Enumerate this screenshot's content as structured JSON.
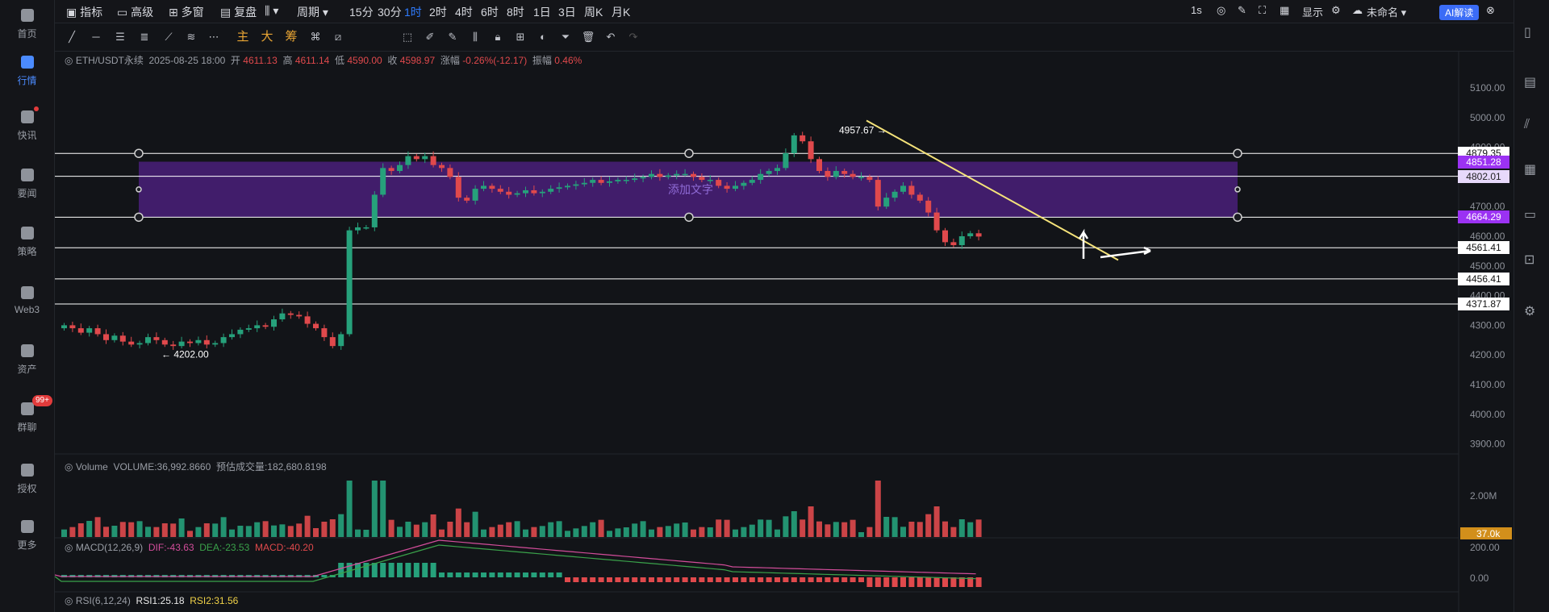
{
  "nav": [
    {
      "label": "首页",
      "icon": "home-icon"
    },
    {
      "label": "行情",
      "icon": "bar-chart-icon",
      "active": true
    },
    {
      "label": "快讯",
      "icon": "news-icon",
      "dot": true
    },
    {
      "label": "要闻",
      "icon": "document-icon"
    },
    {
      "label": "策略",
      "icon": "robot-icon"
    },
    {
      "label": "Web3",
      "icon": "web3-icon"
    },
    {
      "label": "资产",
      "icon": "wallet-icon"
    },
    {
      "label": "群聊",
      "icon": "chat-icon",
      "badge": "99+"
    },
    {
      "label": "授权",
      "icon": "key-icon"
    },
    {
      "label": "更多",
      "icon": "grid-icon"
    }
  ],
  "topbar": {
    "indicators": "指标",
    "advanced": "高级",
    "multi_window": "多窗",
    "replay": "复盘",
    "period": "周期",
    "intervals": [
      "15分",
      "30分",
      "1时",
      "2时",
      "4时",
      "6时",
      "8时",
      "1日",
      "3日",
      "周K",
      "月K"
    ],
    "selected_interval": "1时",
    "right_speed": "1s",
    "display": "显示",
    "unnamed": "未命名",
    "ai": "AI解读"
  },
  "toolbar": {
    "cn_tools": [
      "主",
      "大",
      "筹"
    ]
  },
  "info": {
    "symbol": "ETH/USDT永续",
    "datetime": "2025-08-25 18:00",
    "open_label": "开",
    "open": "4611.13",
    "high_label": "高",
    "high": "4611.14",
    "low_label": "低",
    "low": "4590.00",
    "close_label": "收",
    "close": "4598.97",
    "change_label": "涨幅",
    "change": "-0.26%(-12.17)",
    "amp_label": "振幅",
    "amp": "0.46%"
  },
  "price_axis": [
    "5100.00",
    "5000.00",
    "4900.00",
    "4800.00",
    "4700.00",
    "4600.00",
    "4500.00",
    "4400.00",
    "4300.00",
    "4200.00",
    "4100.00",
    "4000.00",
    "3900.00"
  ],
  "price_tags": [
    {
      "value": "4879.35",
      "style": "white"
    },
    {
      "value": "4851.28",
      "style": "purple"
    },
    {
      "value": "4802.01",
      "style": "light"
    },
    {
      "value": "4664.29",
      "style": "purple"
    },
    {
      "value": "4561.41",
      "style": "white"
    },
    {
      "value": "4456.41",
      "style": "white"
    },
    {
      "value": "4371.87",
      "style": "white"
    }
  ],
  "annotations": {
    "high": "4957.67",
    "low": "4202.00",
    "overlay_text": "添加文字"
  },
  "volume": {
    "label": "Volume",
    "value": "VOLUME:36,992.8660",
    "estimated": "预估成交量:182,680.8198",
    "axis": "2.00M",
    "tag": "37.0k"
  },
  "macd": {
    "label": "MACD(12,26,9)",
    "dif": "DIF:-43.63",
    "dea": "DEA:-23.53",
    "macd": "MACD:-40.20",
    "axis_top": "200.00",
    "axis_zero": "0.00"
  },
  "rsi": {
    "label": "RSI(6,12,24)",
    "rsi1": "RSI1:25.18",
    "rsi2": "RSI2:31.56"
  },
  "colors": {
    "up": "#26a17b",
    "down": "#e0494c",
    "accent": "#2f7cff",
    "box": "#4a1f7a",
    "trend": "#f5e37a"
  }
}
